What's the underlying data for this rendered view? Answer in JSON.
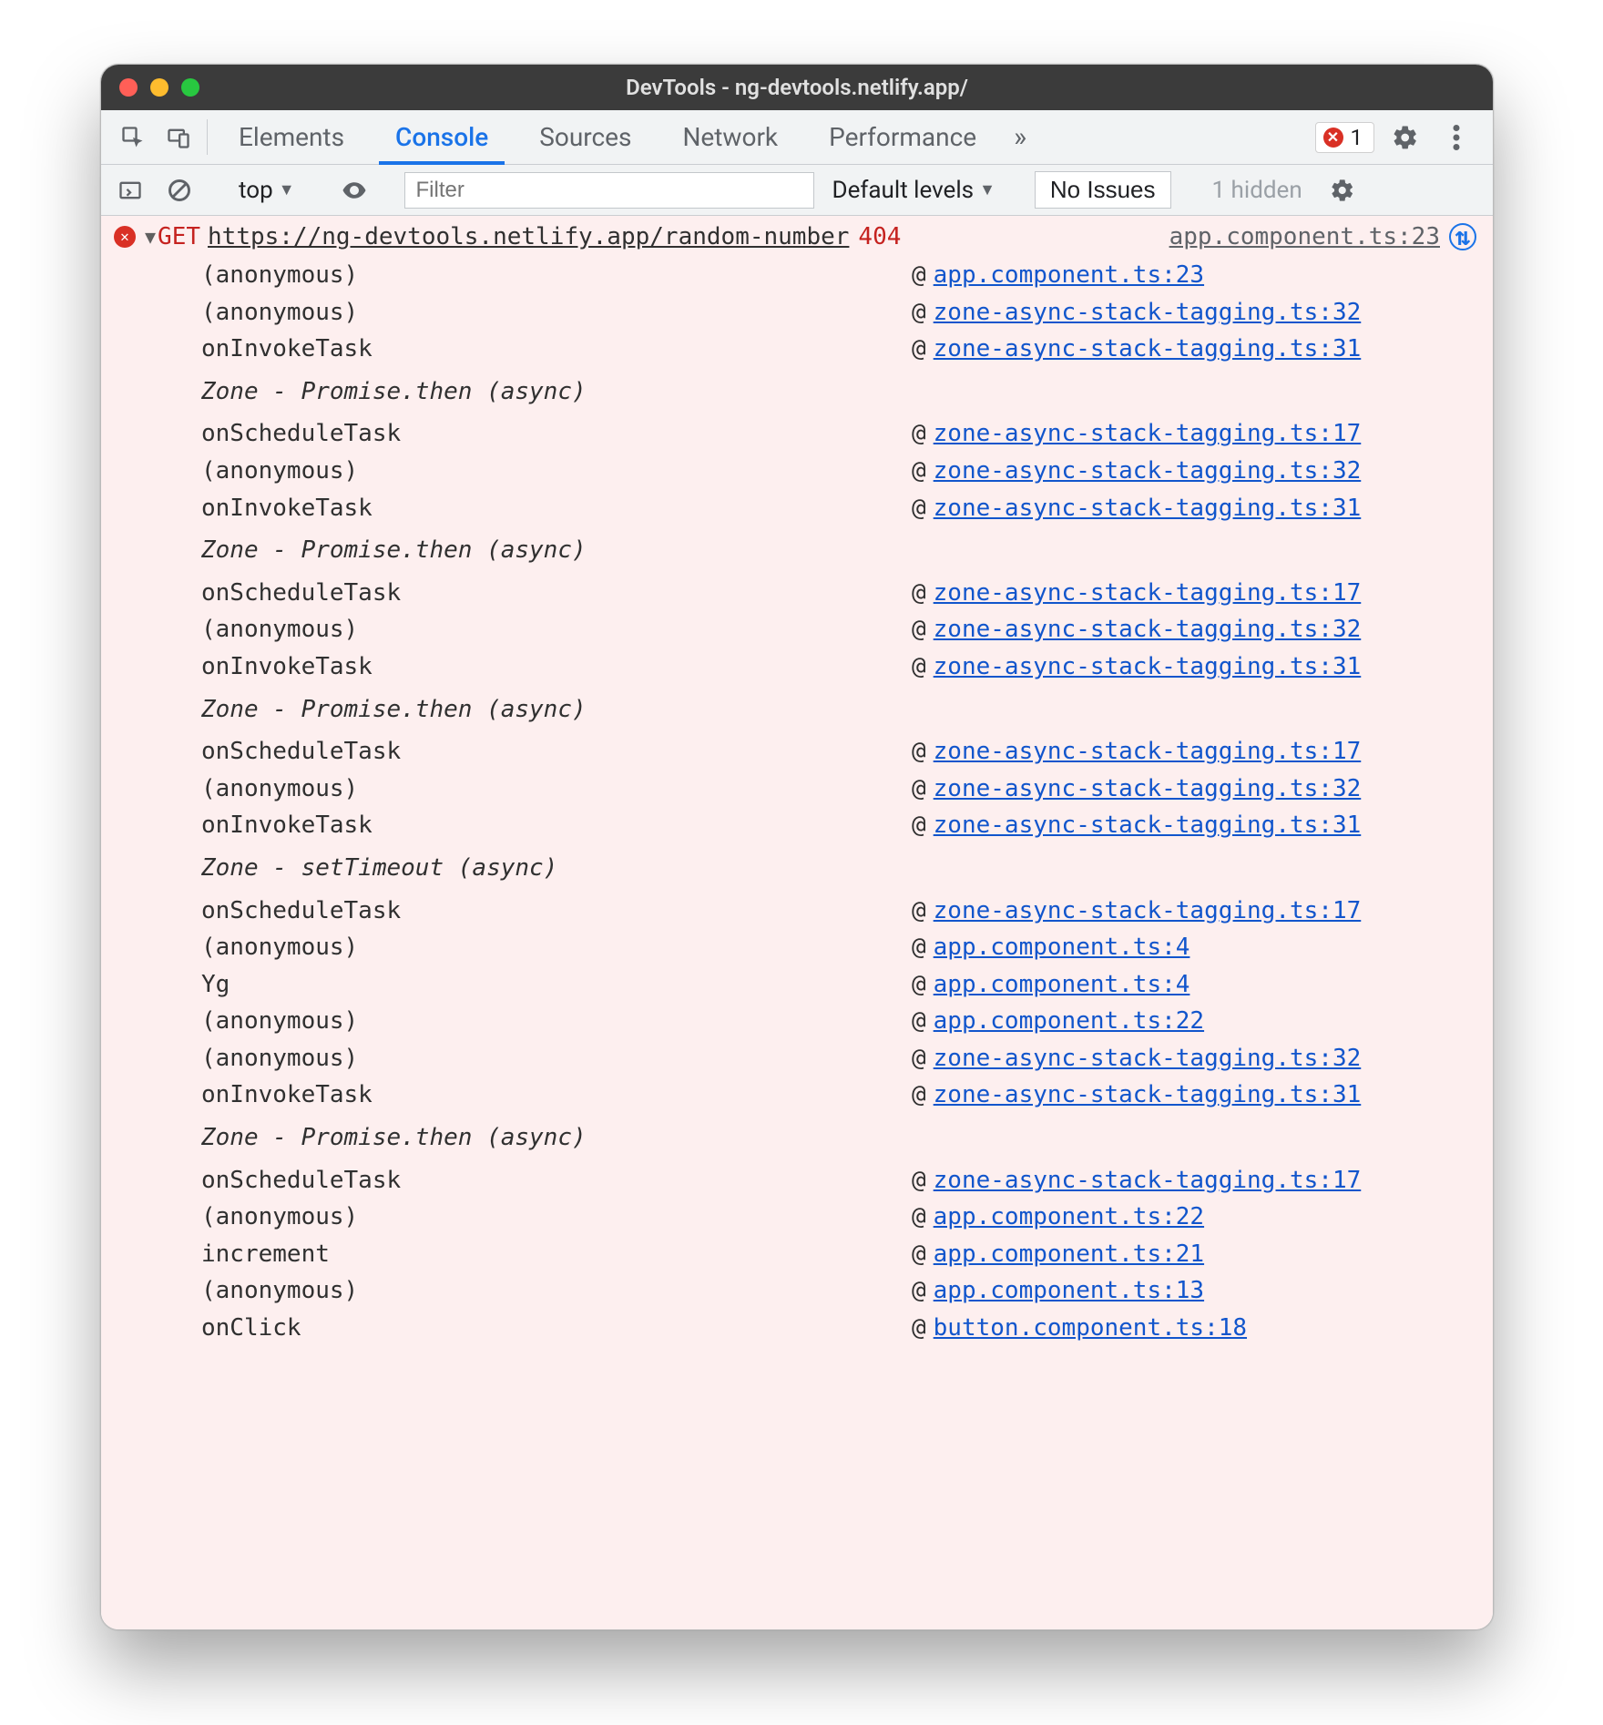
{
  "window": {
    "title": "DevTools - ng-devtools.netlify.app/"
  },
  "tabs": {
    "elements": "Elements",
    "console": "Console",
    "sources": "Sources",
    "network": "Network",
    "performance": "Performance",
    "more": "»"
  },
  "rightTools": {
    "errorCount": "1"
  },
  "consoleToolbar": {
    "context": "top",
    "contextArrow": "▼",
    "filterPlaceholder": "Filter",
    "levels": "Default levels",
    "levelsArrow": "▼",
    "issues": "No Issues",
    "hidden": "1 hidden"
  },
  "error": {
    "disclose": "▼",
    "method": "GET",
    "url": "https://ng-devtools.netlify.app/random-number",
    "status": "404",
    "topSource": "app.component.ts:23",
    "navGlyph": "⇅"
  },
  "stack": [
    {
      "type": "frame",
      "func": "(anonymous)",
      "src": "app.component.ts:23"
    },
    {
      "type": "frame",
      "func": "(anonymous)",
      "src": "zone-async-stack-tagging.ts:32"
    },
    {
      "type": "frame",
      "func": "onInvokeTask",
      "src": "zone-async-stack-tagging.ts:31"
    },
    {
      "type": "async",
      "label": "Zone - Promise.then (async)"
    },
    {
      "type": "frame",
      "func": "onScheduleTask",
      "src": "zone-async-stack-tagging.ts:17"
    },
    {
      "type": "frame",
      "func": "(anonymous)",
      "src": "zone-async-stack-tagging.ts:32"
    },
    {
      "type": "frame",
      "func": "onInvokeTask",
      "src": "zone-async-stack-tagging.ts:31"
    },
    {
      "type": "async",
      "label": "Zone - Promise.then (async)"
    },
    {
      "type": "frame",
      "func": "onScheduleTask",
      "src": "zone-async-stack-tagging.ts:17"
    },
    {
      "type": "frame",
      "func": "(anonymous)",
      "src": "zone-async-stack-tagging.ts:32"
    },
    {
      "type": "frame",
      "func": "onInvokeTask",
      "src": "zone-async-stack-tagging.ts:31"
    },
    {
      "type": "async",
      "label": "Zone - Promise.then (async)"
    },
    {
      "type": "frame",
      "func": "onScheduleTask",
      "src": "zone-async-stack-tagging.ts:17"
    },
    {
      "type": "frame",
      "func": "(anonymous)",
      "src": "zone-async-stack-tagging.ts:32"
    },
    {
      "type": "frame",
      "func": "onInvokeTask",
      "src": "zone-async-stack-tagging.ts:31"
    },
    {
      "type": "async",
      "label": "Zone - setTimeout (async)"
    },
    {
      "type": "frame",
      "func": "onScheduleTask",
      "src": "zone-async-stack-tagging.ts:17"
    },
    {
      "type": "frame",
      "func": "(anonymous)",
      "src": "app.component.ts:4"
    },
    {
      "type": "frame",
      "func": "Yg",
      "src": "app.component.ts:4"
    },
    {
      "type": "frame",
      "func": "(anonymous)",
      "src": "app.component.ts:22"
    },
    {
      "type": "frame",
      "func": "(anonymous)",
      "src": "zone-async-stack-tagging.ts:32"
    },
    {
      "type": "frame",
      "func": "onInvokeTask",
      "src": "zone-async-stack-tagging.ts:31"
    },
    {
      "type": "async",
      "label": "Zone - Promise.then (async)"
    },
    {
      "type": "frame",
      "func": "onScheduleTask",
      "src": "zone-async-stack-tagging.ts:17"
    },
    {
      "type": "frame",
      "func": "(anonymous)",
      "src": "app.component.ts:22"
    },
    {
      "type": "frame",
      "func": "increment",
      "src": "app.component.ts:21"
    },
    {
      "type": "frame",
      "func": "(anonymous)",
      "src": "app.component.ts:13"
    },
    {
      "type": "frame",
      "func": "onClick",
      "src": "button.component.ts:18"
    }
  ]
}
